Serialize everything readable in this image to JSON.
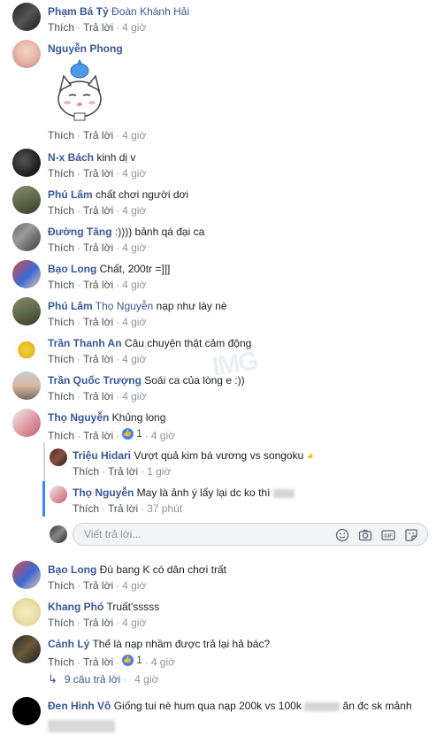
{
  "actions": {
    "like": "Thích",
    "reply": "Trả lời",
    "sep": "·"
  },
  "comments": [
    {
      "author": "Phạm Bá Tỷ",
      "mention": "Đoàn Khánh Hải",
      "text": "",
      "time": "4 giờ",
      "likes": ""
    },
    {
      "author": "Nguyễn Phong",
      "mention": "",
      "text": "",
      "time": "4 giờ",
      "likes": "",
      "sticker": "cat-sticker"
    },
    {
      "author": "N-x Bách",
      "mention": "",
      "text": "kinh dị v",
      "time": "4 giờ",
      "likes": ""
    },
    {
      "author": "Phú Lâm",
      "mention": "",
      "text": "chất chơi người dơi",
      "time": "4 giờ",
      "likes": ""
    },
    {
      "author": "Đường Tăng",
      "mention": "",
      "text": ":)))) bảnh qá đại ca",
      "time": "4 giờ",
      "likes": ""
    },
    {
      "author": "Bạo Long",
      "mention": "",
      "text": "Chất, 200tr =]]]",
      "time": "4 giờ",
      "likes": ""
    },
    {
      "author": "Phú Lâm",
      "mention": "Thọ Nguyễn",
      "text": "nạp như lày nè",
      "time": "4 giờ",
      "likes": ""
    },
    {
      "author": "Trần Thanh An",
      "mention": "",
      "text": "Câu chuyện thật cảm động",
      "time": "4 giờ",
      "likes": ""
    },
    {
      "author": "Trần Quốc Trượng",
      "mention": "",
      "text": "Soái ca của lòng e :))",
      "time": "4 giờ",
      "likes": ""
    },
    {
      "author": "Thọ Nguyễn",
      "mention": "",
      "text": "Khủng long",
      "time": "4 giờ",
      "likes": "1"
    },
    {
      "author": "Bạo Long",
      "mention": "",
      "text": "Đù bang K có dân chơi trất",
      "time": "4 giờ",
      "likes": ""
    },
    {
      "author": "Khang Phó",
      "mention": "",
      "text": "Truất'sssss",
      "time": "4 giờ",
      "likes": ""
    },
    {
      "author": "Cảnh Lý",
      "mention": "",
      "text": "Thế là nạp nhầm được trả lại hả bác?",
      "time": "4 giờ",
      "likes": "1"
    },
    {
      "author": "Đen Hình Vô",
      "mention": "",
      "text": "Giống tui nè hum qua nạp 200k vs 100k",
      "text2": "ăn đc sk mảnh",
      "time": "",
      "likes": ""
    }
  ],
  "replies": [
    {
      "author": "Triệu Hidari",
      "text": "Vượt quả kim bá vương vs songoku",
      "time": "1 giờ"
    },
    {
      "author": "Thọ Nguyễn",
      "text": "May là ảnh ý lấy lại dc ko thì",
      "time": "37 phút"
    }
  ],
  "reply_box": {
    "placeholder": "Viết trả lời..."
  },
  "more_replies": {
    "label": "9 câu trả lời",
    "time": "4 giờ"
  },
  "colors": {
    "author": "#385898",
    "meta": "#90949c",
    "like_blue": "#4080ff",
    "thread_active": "#4080ff"
  }
}
